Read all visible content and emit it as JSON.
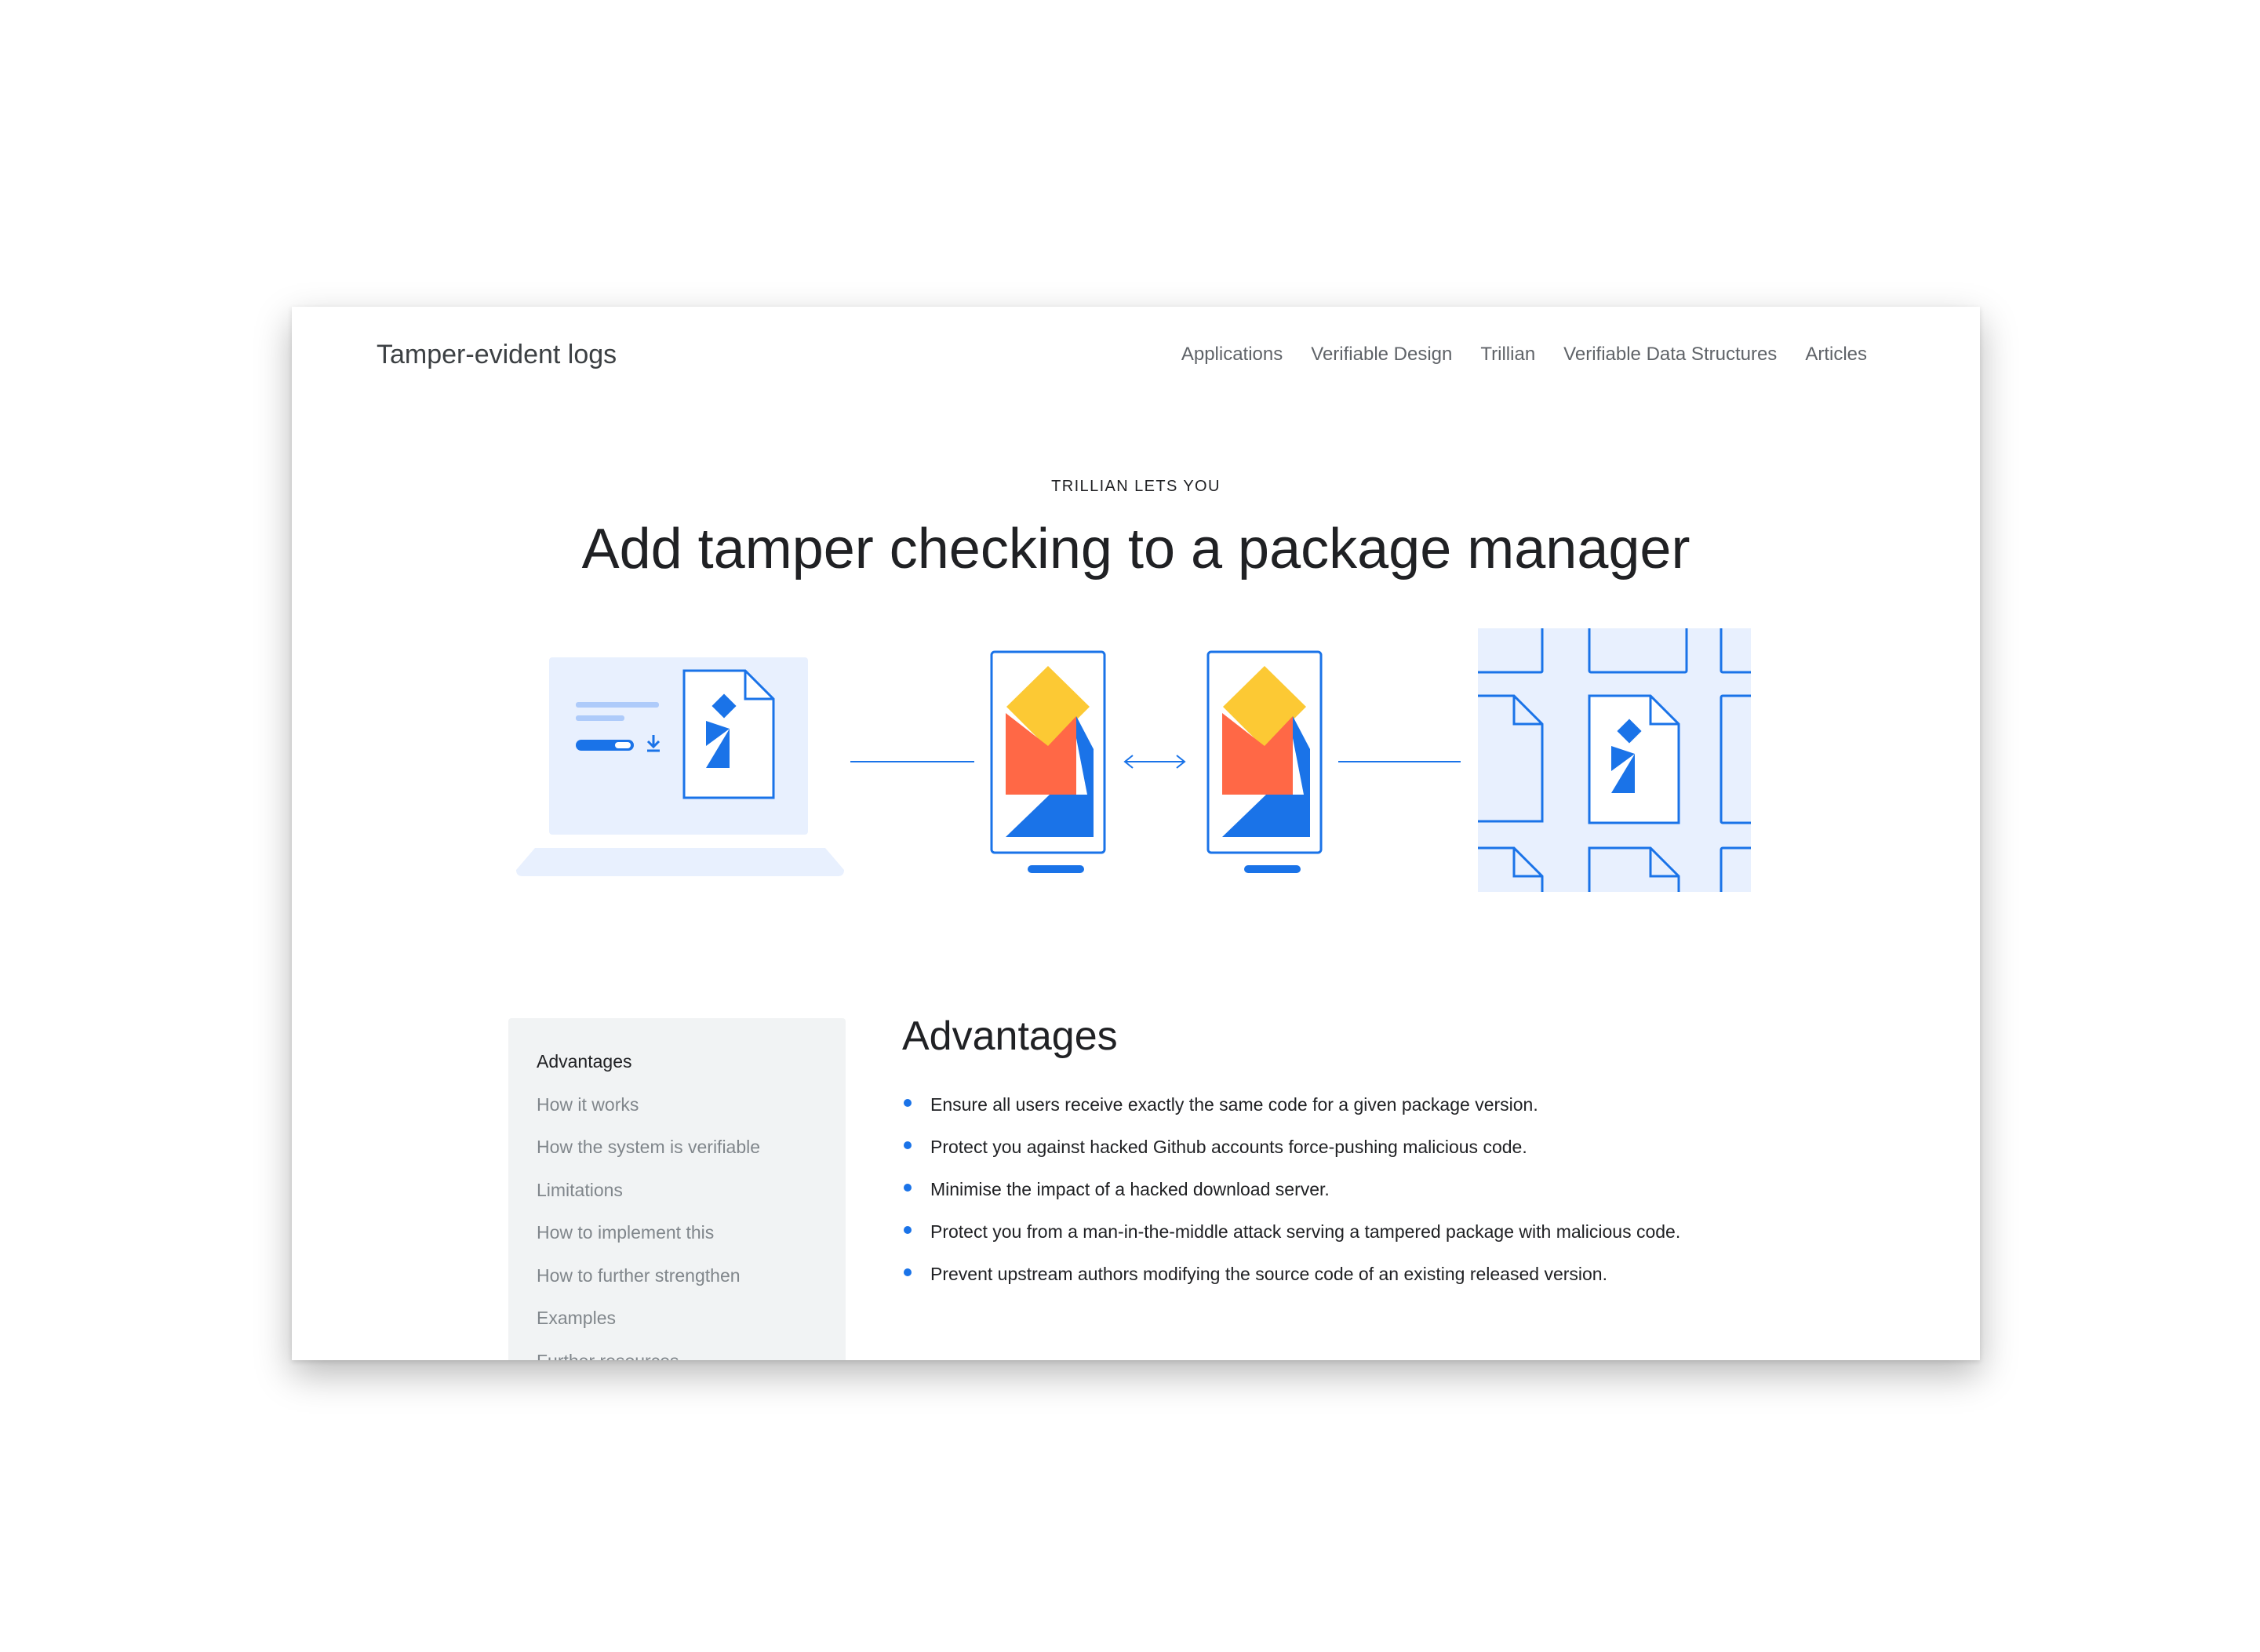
{
  "header": {
    "site_title": "Tamper-evident logs",
    "nav": [
      "Applications",
      "Verifiable Design",
      "Trillian",
      "Verifiable Data Structures",
      "Articles"
    ]
  },
  "hero": {
    "eyebrow": "TRILLIAN LETS YOU",
    "headline": "Add tamper checking to a package manager",
    "illustration_icons": [
      "laptop-download-icon",
      "phone-logo-icon",
      "two-way-arrow-icon",
      "phone-logo-icon",
      "document-grid-icon"
    ]
  },
  "sidebar": {
    "items": [
      "Advantages",
      "How it works",
      "How the system is verifiable",
      "Limitations",
      "How to implement this",
      "How to further strengthen",
      "Examples",
      "Further resources"
    ],
    "active_index": 0
  },
  "main": {
    "heading": "Advantages",
    "bullets": [
      "Ensure all users receive exactly the same code for a given package version.",
      "Protect you against hacked Github accounts force-pushing malicious code.",
      "Minimise the impact of a hacked download server.",
      "Protect you from a man-in-the-middle attack serving a tampered package with malicious code.",
      "Prevent upstream authors modifying the source code of an existing released version."
    ]
  },
  "colors": {
    "blue": "#1a73e8",
    "light_blue": "#e8f0fe",
    "yellow": "#fcc934",
    "red": "#ff6846",
    "sidebar_bg": "#f1f3f4"
  }
}
